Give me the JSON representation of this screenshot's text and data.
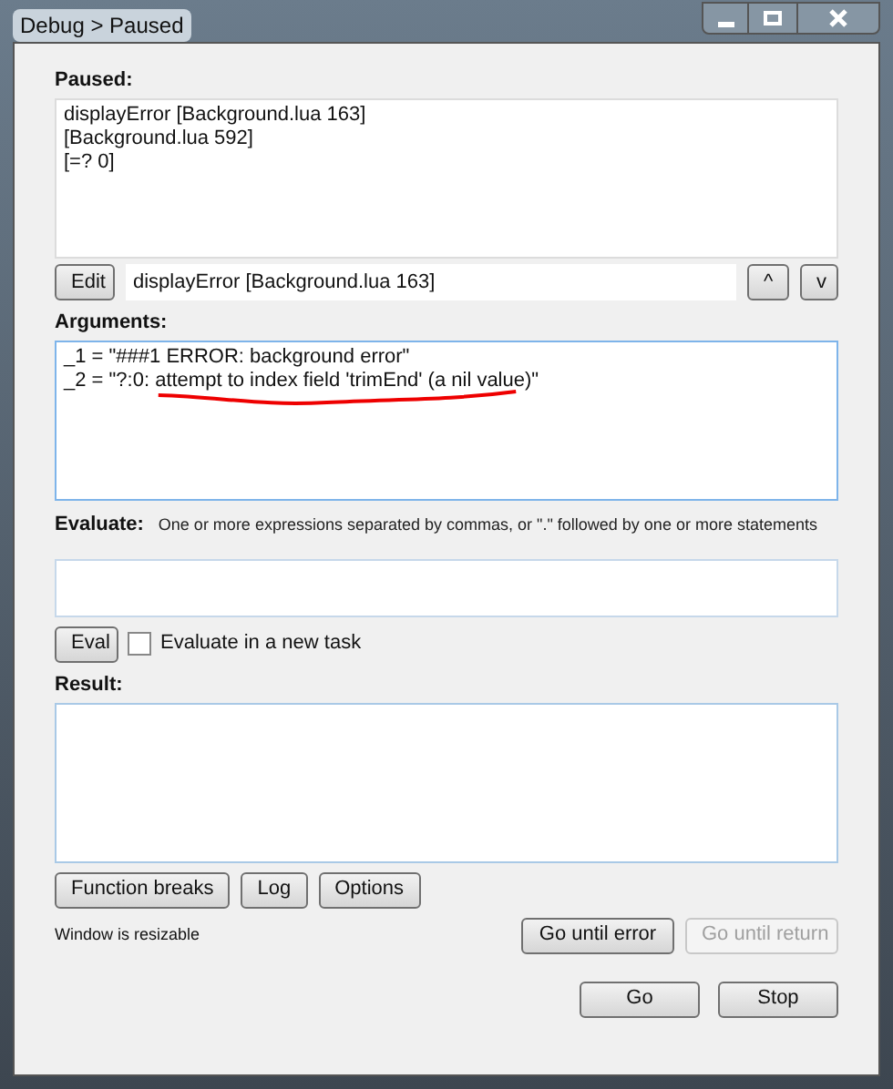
{
  "window": {
    "title": "Debug > Paused"
  },
  "paused": {
    "label": "Paused:",
    "lines": [
      "displayError [Background.lua 163]",
      "[Background.lua 592]",
      "[=? 0]"
    ]
  },
  "frame_bar": {
    "edit_button": "Edit",
    "value": "displayError [Background.lua 163]",
    "up_button": "^",
    "down_button": "v"
  },
  "arguments": {
    "label": "Arguments:",
    "lines": [
      "_1 = \"###1 ERROR: background error\"",
      "_2 = \"?:0: attempt to index field 'trimEnd' (a nil value)\""
    ]
  },
  "evaluate": {
    "label": "Evaluate:",
    "hint": "One or more expressions separated by commas, or \".\" followed by one or more statements"
  },
  "eval_row": {
    "button": "Eval",
    "checkbox": {
      "label": "Evaluate in a new task",
      "checked": false
    }
  },
  "result": {
    "label": "Result:"
  },
  "tool_buttons": [
    {
      "label": "Function breaks",
      "disabled": false
    },
    {
      "label": "Log",
      "disabled": false
    },
    {
      "label": "Options",
      "disabled": false
    }
  ],
  "status": "Window is resizable",
  "go_buttons": [
    {
      "label": "Go until error",
      "disabled": false
    },
    {
      "label": "Go until return",
      "disabled": true
    }
  ],
  "bottom_buttons": [
    {
      "label": "Go",
      "disabled": false
    },
    {
      "label": "Stop",
      "disabled": false
    }
  ]
}
